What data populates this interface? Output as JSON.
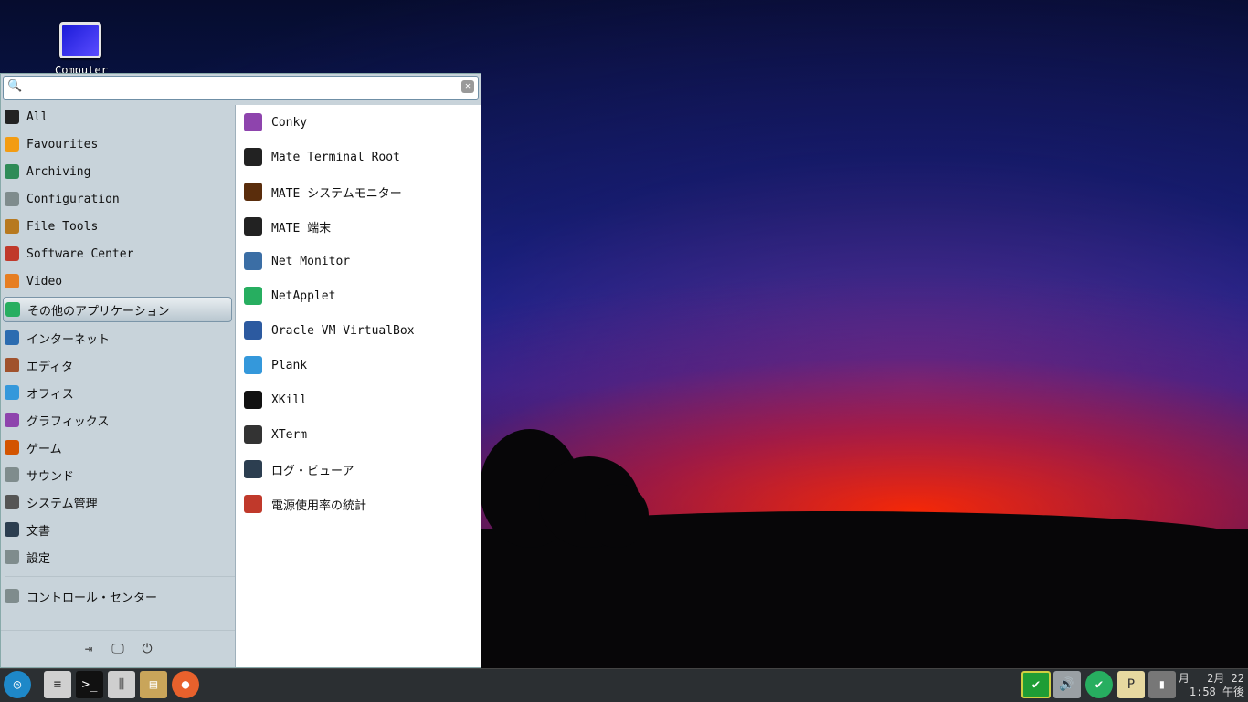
{
  "desktop": {
    "icon_label": "Computer"
  },
  "search": {
    "value": "",
    "placeholder": ""
  },
  "categories": [
    {
      "label": "All",
      "icon": "star-icon",
      "color": "#222222"
    },
    {
      "label": "Favourites",
      "icon": "favourites-icon",
      "color": "#f39c12"
    },
    {
      "label": "Archiving",
      "icon": "archive-icon",
      "color": "#2e8b57"
    },
    {
      "label": "Configuration",
      "icon": "configuration-icon",
      "color": "#7f8c8d"
    },
    {
      "label": "File Tools",
      "icon": "file-tools-icon",
      "color": "#b7791f"
    },
    {
      "label": "Software Center",
      "icon": "software-center-icon",
      "color": "#c0392b"
    },
    {
      "label": "Video",
      "icon": "video-icon",
      "color": "#e67e22"
    },
    {
      "label": "その他のアプリケーション",
      "icon": "other-apps-icon",
      "color": "#27ae60"
    },
    {
      "label": "インターネット",
      "icon": "internet-icon",
      "color": "#2b6cb0"
    },
    {
      "label": "エディタ",
      "icon": "editor-icon",
      "color": "#a0522d"
    },
    {
      "label": "オフィス",
      "icon": "office-icon",
      "color": "#3498db"
    },
    {
      "label": "グラフィックス",
      "icon": "graphics-icon",
      "color": "#8e44ad"
    },
    {
      "label": "ゲーム",
      "icon": "game-icon",
      "color": "#d35400"
    },
    {
      "label": "サウンド",
      "icon": "sound-icon",
      "color": "#7f8c8d"
    },
    {
      "label": "システム管理",
      "icon": "system-admin-icon",
      "color": "#555555"
    },
    {
      "label": "文書",
      "icon": "document-icon",
      "color": "#2c3e50"
    },
    {
      "label": "設定",
      "icon": "settings-icon",
      "color": "#7f8c8d"
    }
  ],
  "selected_category_index": 7,
  "bottom_category": {
    "label": "コントロール・センター",
    "icon": "control-center-icon",
    "color": "#7f8c8d"
  },
  "apps": [
    {
      "label": "Conky",
      "icon": "conky-icon",
      "color": "#8e44ad"
    },
    {
      "label": "Mate Terminal Root",
      "icon": "terminal-root-icon",
      "color": "#222222"
    },
    {
      "label": "MATE システムモニター",
      "icon": "system-monitor-icon",
      "color": "#5a2d0c"
    },
    {
      "label": "MATE 端末",
      "icon": "terminal-icon",
      "color": "#222222"
    },
    {
      "label": "Net Monitor",
      "icon": "net-monitor-icon",
      "color": "#3b6ea5"
    },
    {
      "label": "NetApplet",
      "icon": "netapplet-icon",
      "color": "#27ae60"
    },
    {
      "label": "Oracle VM VirtualBox",
      "icon": "virtualbox-icon",
      "color": "#2c5aa0"
    },
    {
      "label": "Plank",
      "icon": "plank-icon",
      "color": "#3498db"
    },
    {
      "label": "XKill",
      "icon": "xkill-icon",
      "color": "#111111"
    },
    {
      "label": "XTerm",
      "icon": "xterm-icon",
      "color": "#333333"
    },
    {
      "label": "ログ・ビューア",
      "icon": "log-viewer-icon",
      "color": "#2c3e50"
    },
    {
      "label": "電源使用率の統計",
      "icon": "power-stats-icon",
      "color": "#c0392b"
    }
  ],
  "clock": {
    "date": "月　 2月 22",
    "time": "1:58 午後"
  }
}
